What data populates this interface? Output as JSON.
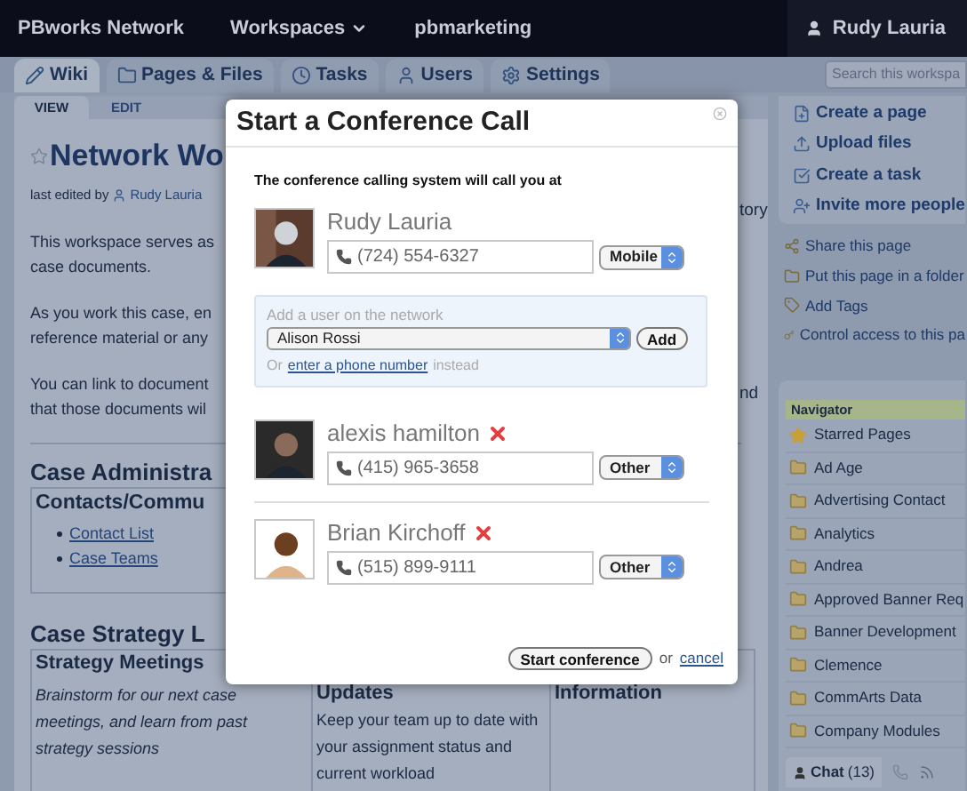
{
  "top_bar": {
    "items": [
      {
        "label": "PBworks Network",
        "kind": "link"
      },
      {
        "label": "Workspaces",
        "kind": "menu"
      },
      {
        "label": "pbmarketing",
        "kind": "link"
      }
    ],
    "user": "Rudy Lauria"
  },
  "tabs": [
    {
      "label": "Wiki",
      "selected": true
    },
    {
      "label": "Pages & Files",
      "selected": false
    },
    {
      "label": "Tasks",
      "selected": false
    },
    {
      "label": "Users",
      "selected": false
    },
    {
      "label": "Settings",
      "selected": false
    }
  ],
  "search": {
    "placeholder": "Search this workspa"
  },
  "page_tabs": [
    {
      "label": "VIEW",
      "selected": true
    },
    {
      "label": "EDIT",
      "selected": false
    }
  ],
  "page": {
    "title": "Network Wo",
    "edited_label": "last edited by",
    "edited_user": "Rudy Lauria",
    "paragraphs": [
      [
        "This workspace serves as",
        "case documents."
      ],
      [
        "As you work this case, en",
        "reference material or any"
      ],
      [
        "You can link to document",
        "that those documents wil"
      ]
    ],
    "right_fragments": [
      "tory",
      "nd"
    ],
    "admin": {
      "heading": "Case Administra",
      "box_title": "Contacts/Commu",
      "links": [
        "Contact List",
        "Case Teams"
      ]
    },
    "strategy": {
      "heading": "Case Strategy L",
      "cells": [
        {
          "title": "Strategy Meetings",
          "text": "Brainstorm for our next case meetings, and learn from past strategy sessions"
        },
        {
          "title": "Updates",
          "text": "Keep your team up to date with your assignment status and current workload"
        },
        {
          "title": "Information"
        }
      ]
    }
  },
  "sidebar": {
    "actions": [
      "Create a page",
      "Upload files",
      "Create a task",
      "Invite more people"
    ],
    "links": [
      "Share this page",
      "Put this page in a folder",
      "Add Tags",
      "Control access to this pa"
    ],
    "navigator": {
      "title": "Navigator",
      "items": [
        {
          "label": "Starred Pages",
          "kind": "star"
        },
        {
          "label": "Ad Age",
          "kind": "folder"
        },
        {
          "label": "Advertising Contact",
          "kind": "folder"
        },
        {
          "label": "Analytics",
          "kind": "folder"
        },
        {
          "label": "Andrea",
          "kind": "folder"
        },
        {
          "label": "Approved Banner Req",
          "kind": "folder"
        },
        {
          "label": "Banner Development",
          "kind": "folder"
        },
        {
          "label": "Clemence",
          "kind": "folder"
        },
        {
          "label": "CommArts Data",
          "kind": "folder"
        },
        {
          "label": "Company Modules",
          "kind": "folder"
        }
      ]
    },
    "chat": {
      "label": "Chat",
      "count": "(13)"
    }
  },
  "modal": {
    "title": "Start a Conference Call",
    "intro": "The conference calling system will call you at",
    "caller": {
      "name": "Rudy Lauria",
      "phone": "(724) 554-6327",
      "phone_type": "Mobile",
      "removable": false
    },
    "add_user": {
      "label": "Add a user on the network",
      "value": "Alison Rossi",
      "button": "Add",
      "or": "Or",
      "link": "enter a phone number",
      "after": "instead"
    },
    "participants": [
      {
        "name": "alexis hamilton",
        "phone": "(415) 965-3658",
        "phone_type": "Other",
        "removable": true
      },
      {
        "name": "Brian Kirchoff",
        "phone": "(515) 899-9111",
        "phone_type": "Other",
        "removable": true
      }
    ],
    "start_button": "Start conference",
    "or": "or",
    "cancel": "cancel"
  }
}
